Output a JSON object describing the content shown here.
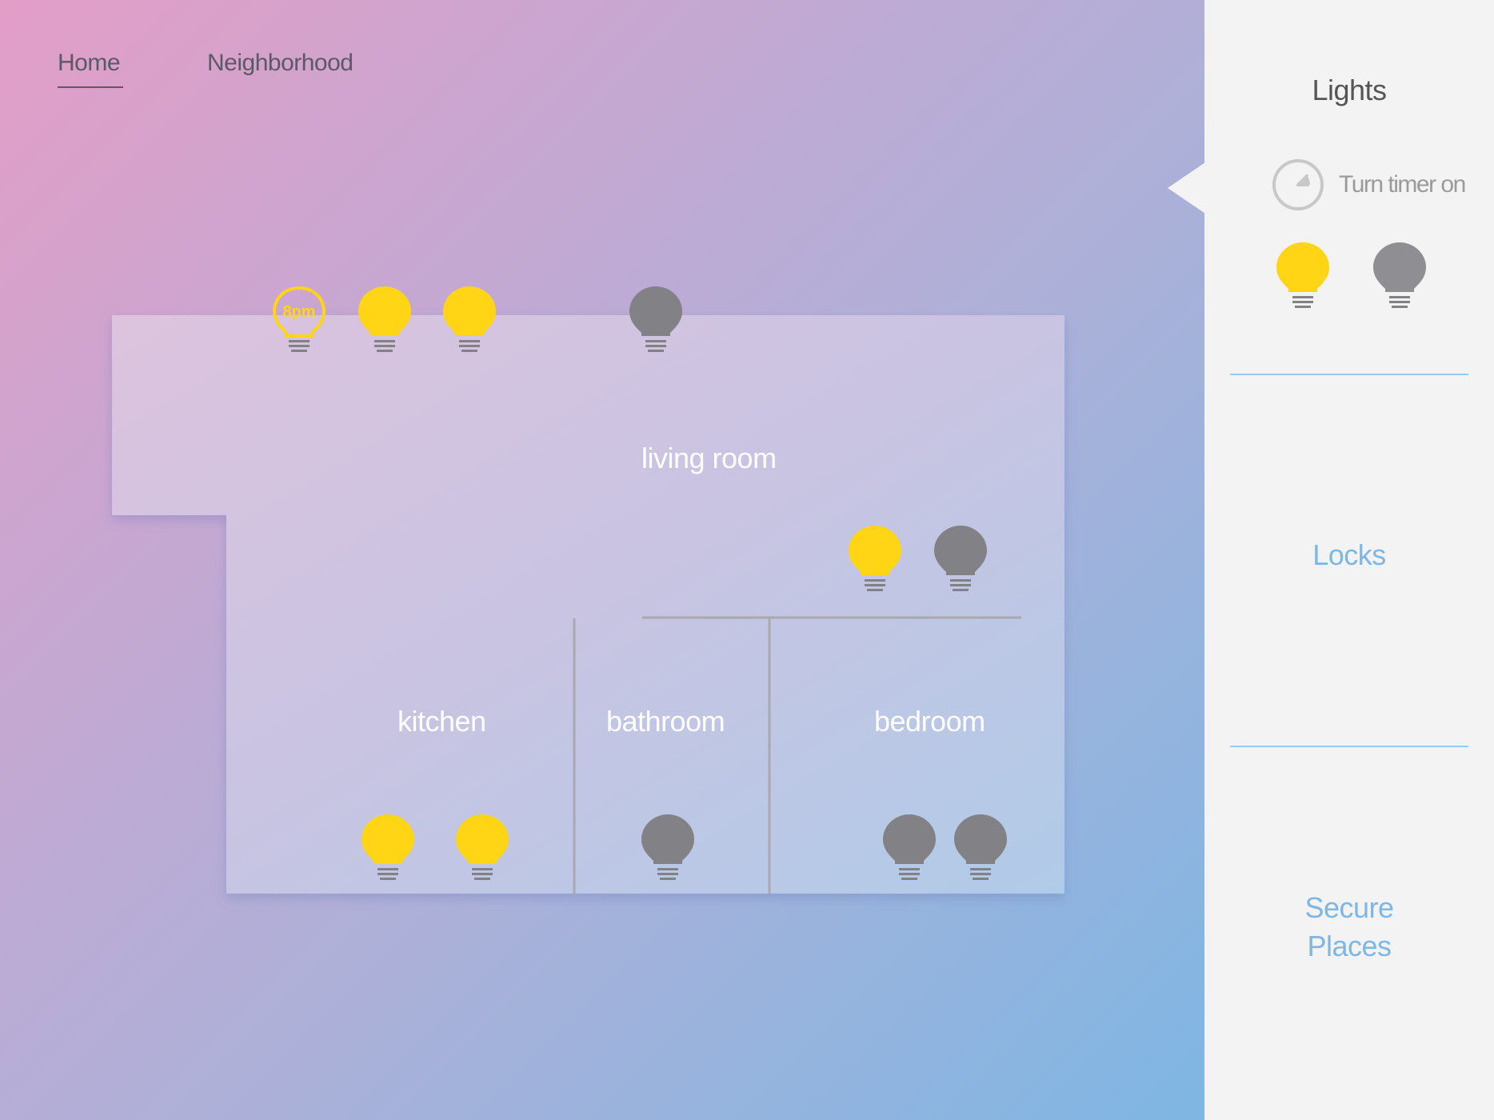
{
  "nav": {
    "tabs": [
      {
        "label": "Home",
        "active": true
      },
      {
        "label": "Neighborhood",
        "active": false
      }
    ]
  },
  "floorplan": {
    "rooms": [
      {
        "name": "living room"
      },
      {
        "name": "kitchen"
      },
      {
        "name": "bathroom"
      },
      {
        "name": "bedroom"
      }
    ],
    "timer_bulb_text": "8pm",
    "bulbs": {
      "living_room": [
        "timer",
        "on",
        "on",
        "off",
        "on",
        "off"
      ],
      "kitchen": [
        "on",
        "on"
      ],
      "bathroom": [
        "off"
      ],
      "bedroom": [
        "off",
        "off"
      ]
    }
  },
  "panel": {
    "title": "Lights",
    "timer_label": "Turn timer on",
    "all_on_state": "on",
    "all_off_state": "off",
    "locks_label": "Locks",
    "secure_label_line1": "Secure",
    "secure_label_line2": "Places"
  },
  "colors": {
    "bulb_on": "#ffd516",
    "bulb_off": "#828286",
    "accent_link": "#7fb6e2",
    "panel_bg": "#f3f3f3"
  }
}
